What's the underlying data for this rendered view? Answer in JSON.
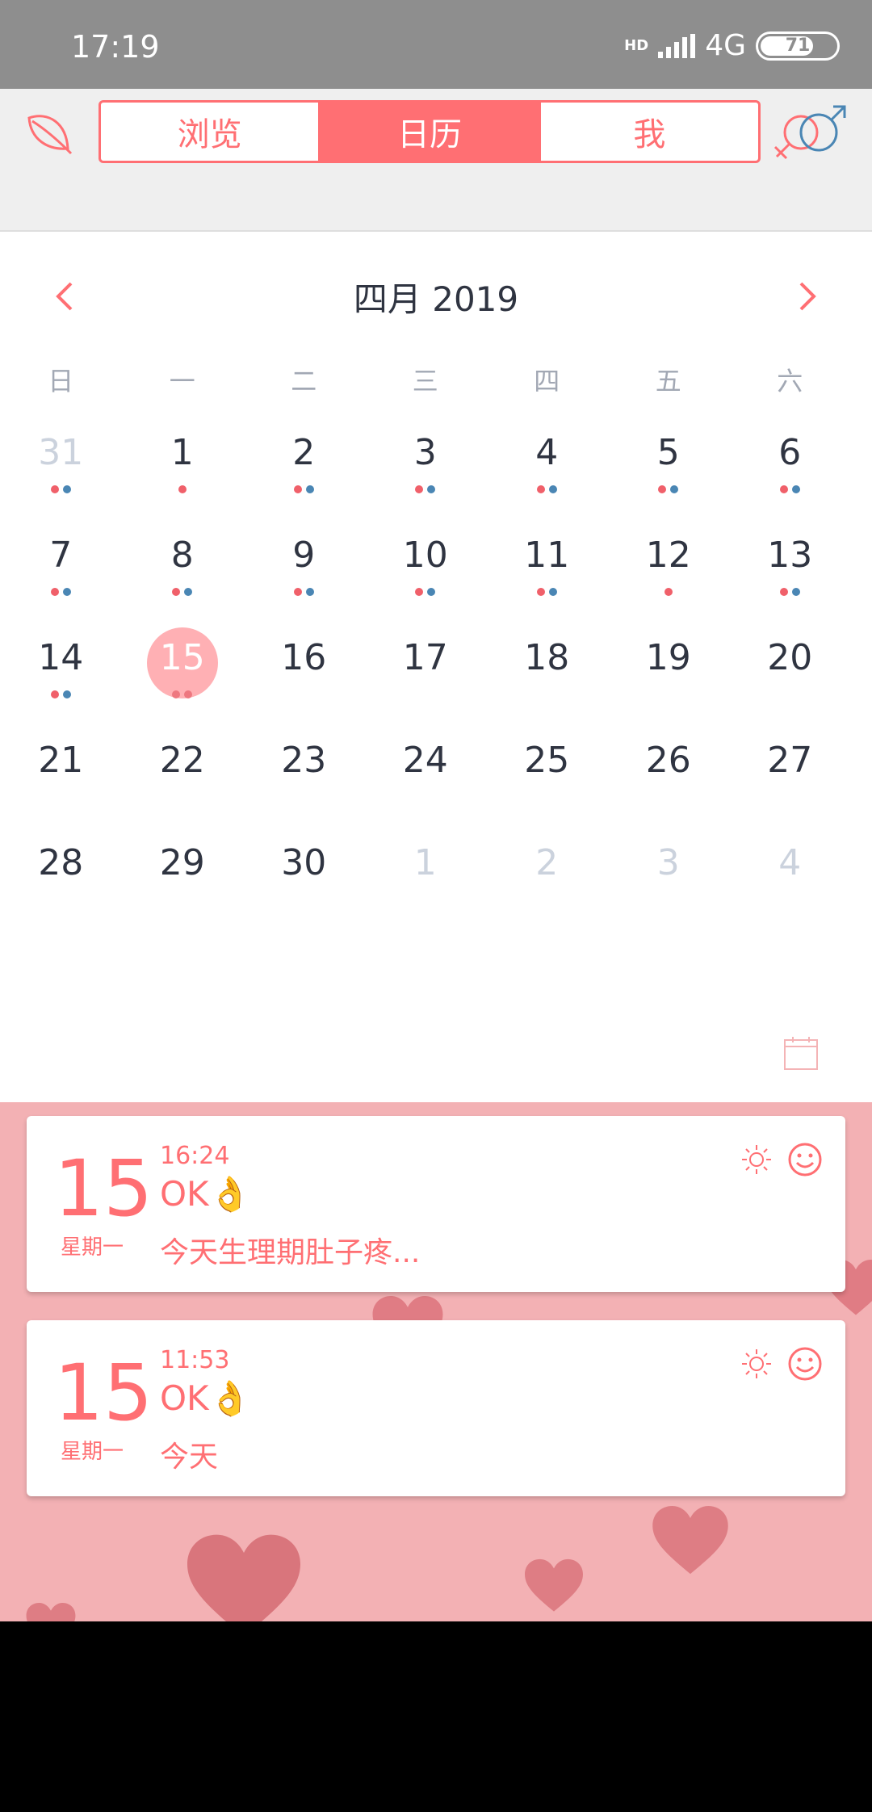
{
  "status_bar": {
    "time": "17:19",
    "network": "4G",
    "hd": "HD",
    "battery": "71",
    "battery_level": 0.71
  },
  "tabs": [
    {
      "label": "浏览",
      "active": false
    },
    {
      "label": "日历",
      "active": true
    },
    {
      "label": "我",
      "active": false
    }
  ],
  "calendar": {
    "month_title": "四月 2019",
    "weekdays": [
      "日",
      "一",
      "二",
      "三",
      "四",
      "五",
      "六"
    ],
    "weeks": [
      [
        {
          "d": "31",
          "muted": true,
          "dots": [
            "red",
            "blue"
          ]
        },
        {
          "d": "1",
          "dots": [
            "red"
          ]
        },
        {
          "d": "2",
          "dots": [
            "red",
            "blue"
          ]
        },
        {
          "d": "3",
          "dots": [
            "red",
            "blue"
          ]
        },
        {
          "d": "4",
          "dots": [
            "red",
            "blue"
          ]
        },
        {
          "d": "5",
          "dots": [
            "red",
            "blue"
          ]
        },
        {
          "d": "6",
          "dots": [
            "red",
            "blue"
          ]
        }
      ],
      [
        {
          "d": "7",
          "dots": [
            "red",
            "blue"
          ]
        },
        {
          "d": "8",
          "dots": [
            "red",
            "blue"
          ]
        },
        {
          "d": "9",
          "dots": [
            "red",
            "blue"
          ]
        },
        {
          "d": "10",
          "dots": [
            "red",
            "blue"
          ]
        },
        {
          "d": "11",
          "dots": [
            "red",
            "blue"
          ]
        },
        {
          "d": "12",
          "dots": [
            "red"
          ]
        },
        {
          "d": "13",
          "dots": [
            "red",
            "blue"
          ]
        }
      ],
      [
        {
          "d": "14",
          "dots": [
            "red",
            "blue"
          ]
        },
        {
          "d": "15",
          "today": true,
          "dots": [
            "red",
            "red"
          ]
        },
        {
          "d": "16"
        },
        {
          "d": "17"
        },
        {
          "d": "18"
        },
        {
          "d": "19"
        },
        {
          "d": "20"
        }
      ],
      [
        {
          "d": "21"
        },
        {
          "d": "22"
        },
        {
          "d": "23"
        },
        {
          "d": "24"
        },
        {
          "d": "25"
        },
        {
          "d": "26"
        },
        {
          "d": "27"
        }
      ],
      [
        {
          "d": "28"
        },
        {
          "d": "29"
        },
        {
          "d": "30"
        },
        {
          "d": "1",
          "muted": true
        },
        {
          "d": "2",
          "muted": true
        },
        {
          "d": "3",
          "muted": true
        },
        {
          "d": "4",
          "muted": true
        }
      ]
    ]
  },
  "entries": [
    {
      "day": "15",
      "weekday": "星期一",
      "time": "16:24",
      "title": "OK👌",
      "text": "今天生理期肚子疼..."
    },
    {
      "day": "15",
      "weekday": "星期一",
      "time": "11:53",
      "title": "OK👌",
      "text": "今天"
    }
  ],
  "colors": {
    "accent": "#ff6f73",
    "today": "#ffb0b4",
    "dot_red": "#f0606a",
    "dot_blue": "#4a86b4",
    "diary_bg": "#f3b1b4"
  }
}
